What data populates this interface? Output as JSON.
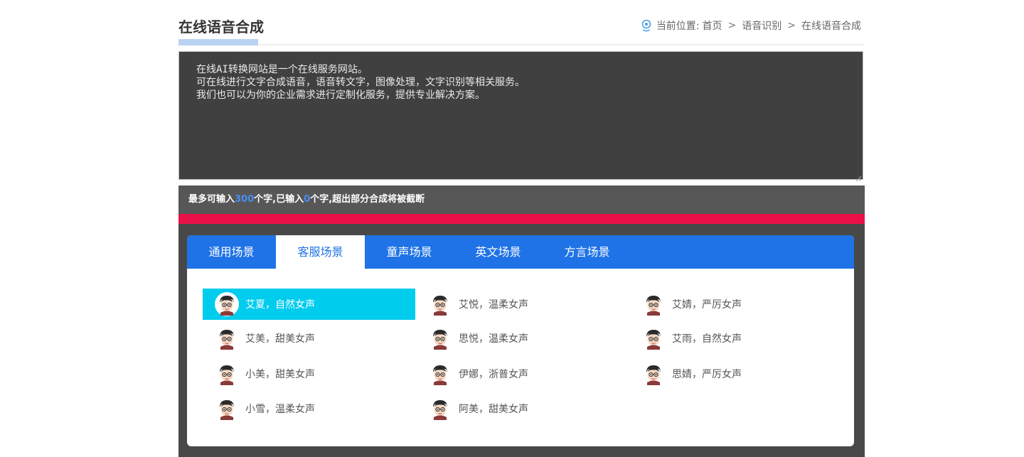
{
  "header": {
    "title": "在线语音合成",
    "breadcrumb": {
      "prefix": "当前位置:",
      "items": [
        "首页",
        "语音识别",
        "在线语音合成"
      ],
      "separator": ">"
    }
  },
  "editor": {
    "text": "在线AI转换网站是一个在线服务网站。\n可在线进行文字合成语音，语音转文字，图像处理，文字识别等相关服务。\n我们也可以为你的企业需求进行定制化服务，提供专业解决方案。"
  },
  "counter": {
    "part1": "最多可输入",
    "max": "300",
    "part2": "个字,已输入",
    "current": "0",
    "part3": "个字,超出部分合成将被截断"
  },
  "tabs": [
    {
      "label": "通用场景"
    },
    {
      "label": "客服场景"
    },
    {
      "label": "童声场景"
    },
    {
      "label": "英文场景"
    },
    {
      "label": "方言场景"
    }
  ],
  "active_tab": "客服场景",
  "voices": [
    {
      "label": "艾夏，自然女声"
    },
    {
      "label": "艾悦，温柔女声"
    },
    {
      "label": "艾婧，严厉女声"
    },
    {
      "label": "艾美，甜美女声"
    },
    {
      "label": "思悦，温柔女声"
    },
    {
      "label": "艾雨，自然女声"
    },
    {
      "label": "小美，甜美女声"
    },
    {
      "label": "伊娜，浙普女声"
    },
    {
      "label": "思婧，严厉女声"
    },
    {
      "label": "小雪，温柔女声"
    },
    {
      "label": "阿美，甜美女声"
    }
  ],
  "selected_voice": "艾夏，自然女声",
  "colors": {
    "accent_blue": "#1f73e6",
    "selected_cyan": "#00ccee",
    "alert_red": "#eb1148"
  }
}
